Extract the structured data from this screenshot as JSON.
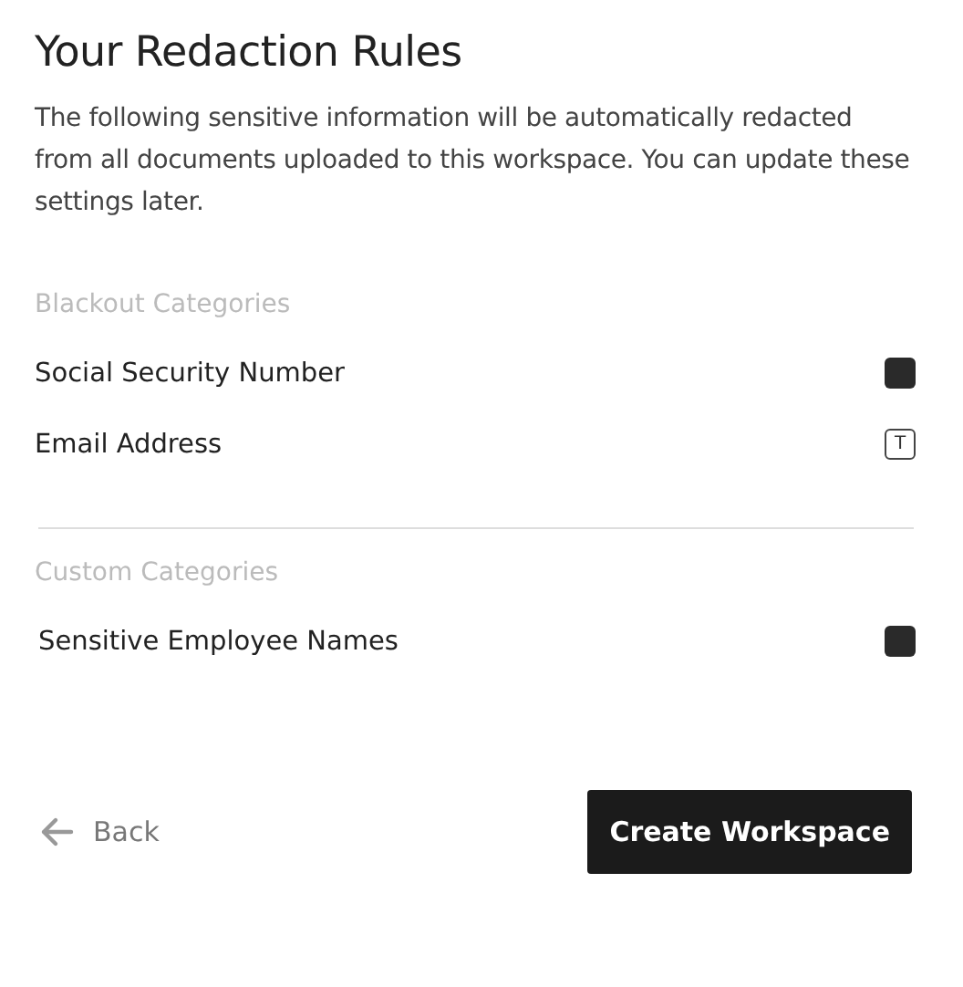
{
  "title": "Your Redaction Rules",
  "description": "The following sensitive information will be automatically redacted from all documents uploaded to this workspace. You can update these settings later.",
  "sections": [
    {
      "heading": "Blackout Categories",
      "items": [
        {
          "label": "Social Security Number",
          "kind": "blackout"
        },
        {
          "label": "Email Address",
          "kind": "text",
          "mark_text": "T"
        }
      ]
    },
    {
      "heading": "Custom Categories",
      "items": [
        {
          "label": "Sensitive Employee Names",
          "kind": "blackout"
        }
      ]
    }
  ],
  "back_label": "Back",
  "primary_button": "Create Workspace"
}
